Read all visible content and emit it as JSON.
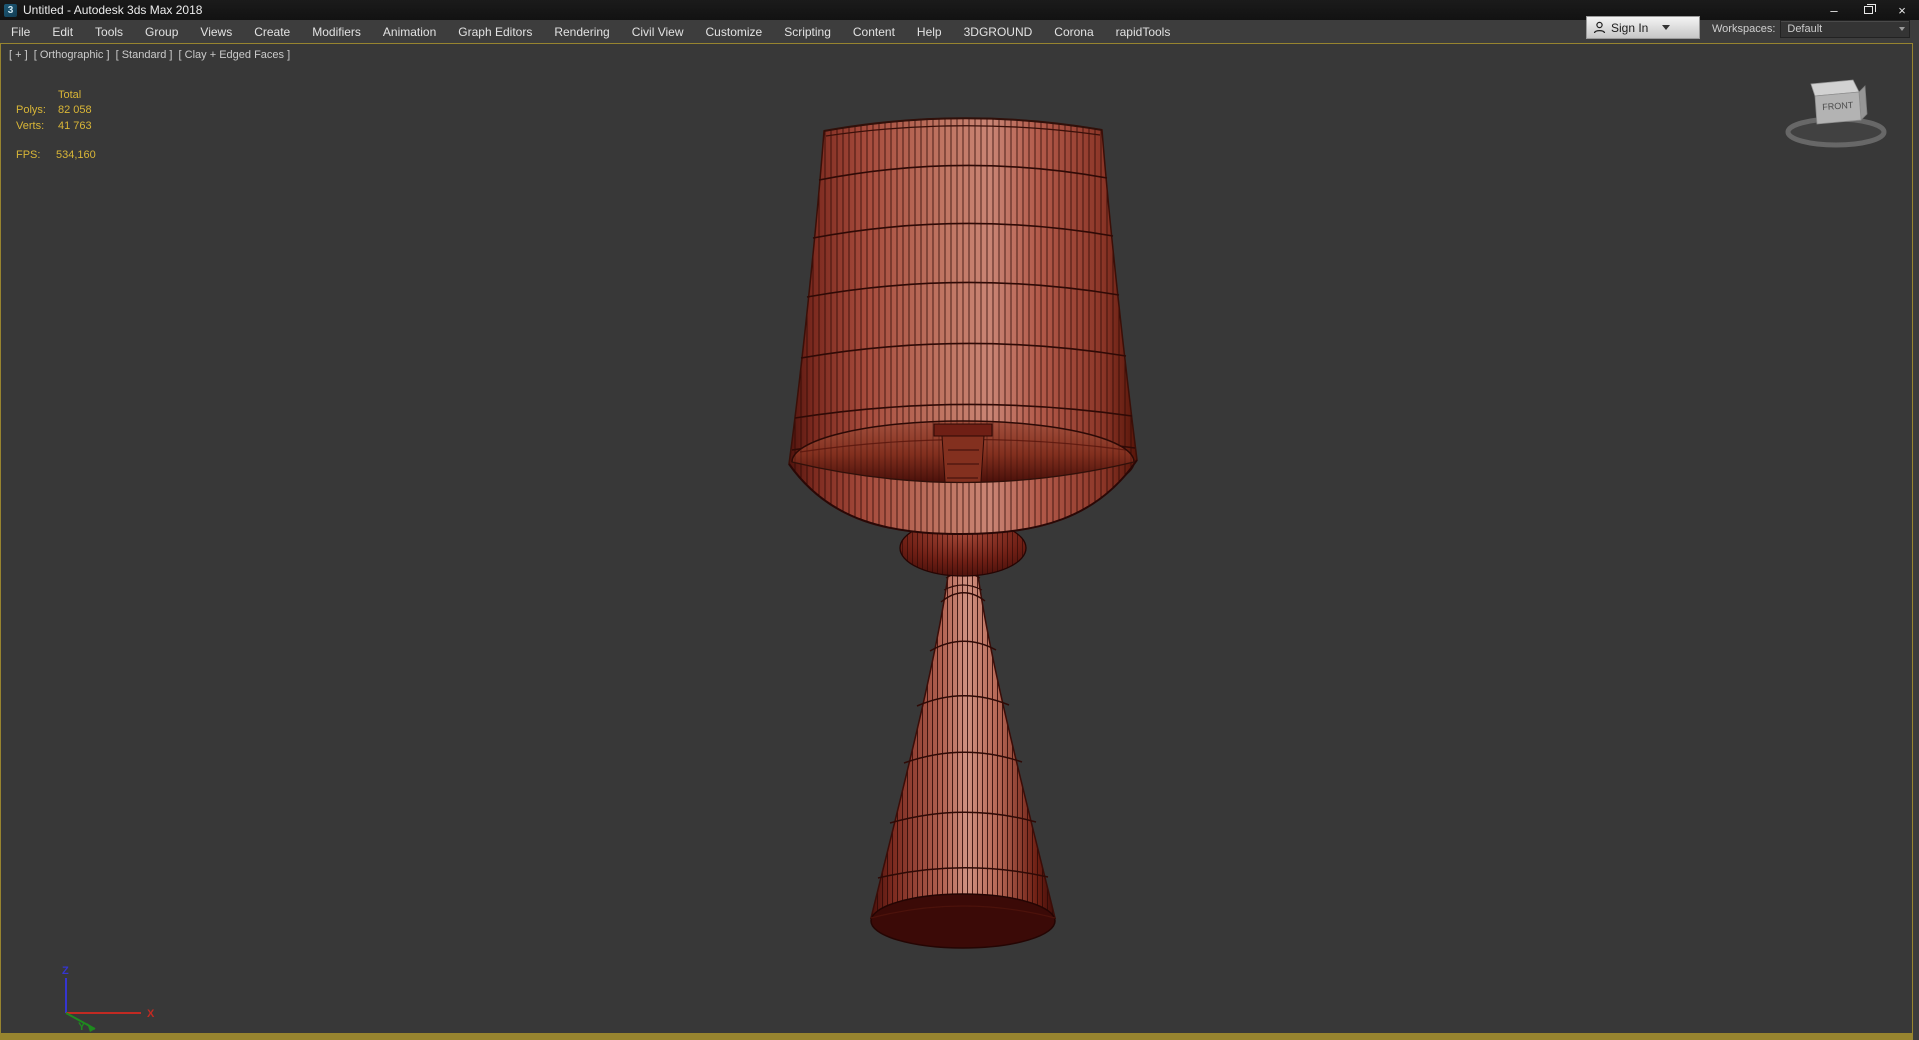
{
  "window": {
    "title": "Untitled - Autodesk 3ds Max 2018",
    "app_icon_glyph": "3",
    "minimize_icon": "–",
    "close_icon": "×"
  },
  "menu_bar": {
    "items": [
      "File",
      "Edit",
      "Tools",
      "Group",
      "Views",
      "Create",
      "Modifiers",
      "Animation",
      "Graph Editors",
      "Rendering",
      "Civil View",
      "Customize",
      "Scripting",
      "Content",
      "Help",
      "3DGROUND",
      "Corona",
      "rapidTools"
    ],
    "sign_in_label": "Sign In",
    "workspaces_label": "Workspaces:",
    "workspaces_value": "Default"
  },
  "viewport": {
    "label_parts": [
      "[ + ]",
      "[ Orthographic ]",
      "[ Standard ]",
      "[ Clay + Edged Faces ]"
    ],
    "stats": {
      "header": "Total",
      "rows": [
        {
          "label": "Polys:",
          "value": "82 058"
        },
        {
          "label": "Verts:",
          "value": "41 763"
        }
      ],
      "fps_label": "FPS:",
      "fps_value": "534,160"
    },
    "view_cube": {
      "front_label": "FRONT"
    },
    "axis_gizmo": {
      "x": "X",
      "y": "Y",
      "z": "Z"
    },
    "colors": {
      "background": "#383838",
      "active_border": "#97842f",
      "stats_text": "#d9b637",
      "clay_red": "#a5443a",
      "clay_highlight": "#c98474",
      "clay_shadow": "#4f130d",
      "wireframe": "#2e0905",
      "axis_x": "#c22a22",
      "axis_y": "#1f8a1f",
      "axis_z": "#3535d0"
    },
    "model": "table-lamp-wireframe"
  }
}
